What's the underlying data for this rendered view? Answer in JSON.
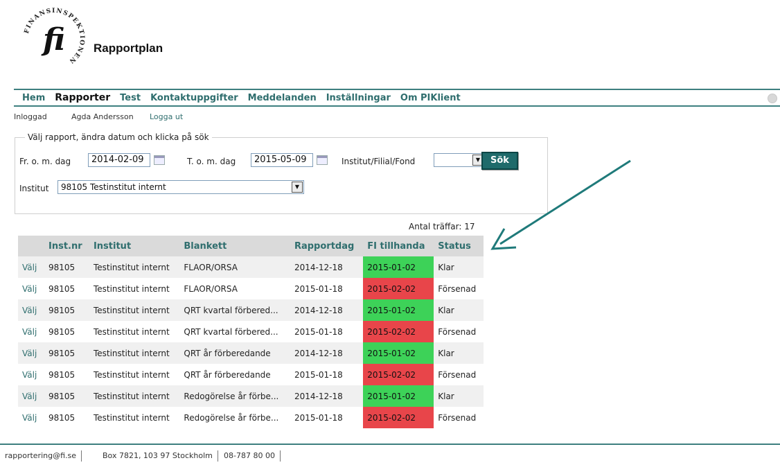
{
  "brand": {
    "ring_text": "FINANSINSPEKTIONEN",
    "monogram": "fi",
    "app_title": "Rapportplan"
  },
  "menu": {
    "items": [
      "Hem",
      "Rapporter",
      "Test",
      "Kontaktuppgifter",
      "Meddelanden",
      "Inställningar",
      "Om PIKlient"
    ],
    "active": "Rapporter"
  },
  "login": {
    "label": "Inloggad",
    "user": "Agda Andersson",
    "logout": "Logga ut"
  },
  "search": {
    "legend": "Välj rapport, ändra datum och klicka på sök",
    "from_label": "Fr. o. m. dag",
    "from_value": "2014-02-09",
    "to_label": "T. o. m. dag",
    "to_value": "2015-05-09",
    "entity_label": "Institut/Filial/Fond",
    "entity_value": "",
    "institut_label": "Institut",
    "institut_value": "98105 Testinstitut internt",
    "search_button": "Sök"
  },
  "results": {
    "hits_text": "Antal träffar: 17",
    "columns": [
      "",
      "Inst.nr",
      "Institut",
      "Blankett",
      "Rapportdag",
      "FI tillhanda",
      "Status"
    ],
    "rows": [
      {
        "action": "Välj",
        "inst_nr": "98105",
        "institut": "Testinstitut internt",
        "blankett": "FLAOR/ORSA",
        "rapportdag": "2014-12-18",
        "fi_tillhanda": "2015-01-02",
        "status": "Klar"
      },
      {
        "action": "Välj",
        "inst_nr": "98105",
        "institut": "Testinstitut internt",
        "blankett": "FLAOR/ORSA",
        "rapportdag": "2015-01-18",
        "fi_tillhanda": "2015-02-02",
        "status": "Försenad"
      },
      {
        "action": "Välj",
        "inst_nr": "98105",
        "institut": "Testinstitut internt",
        "blankett": "QRT kvartal förbered...",
        "rapportdag": "2014-12-18",
        "fi_tillhanda": "2015-01-02",
        "status": "Klar"
      },
      {
        "action": "Välj",
        "inst_nr": "98105",
        "institut": "Testinstitut internt",
        "blankett": "QRT kvartal förbered...",
        "rapportdag": "2015-01-18",
        "fi_tillhanda": "2015-02-02",
        "status": "Försenad"
      },
      {
        "action": "Välj",
        "inst_nr": "98105",
        "institut": "Testinstitut internt",
        "blankett": "QRT år förberedande",
        "rapportdag": "2014-12-18",
        "fi_tillhanda": "2015-01-02",
        "status": "Klar"
      },
      {
        "action": "Välj",
        "inst_nr": "98105",
        "institut": "Testinstitut internt",
        "blankett": "QRT år förberedande",
        "rapportdag": "2015-01-18",
        "fi_tillhanda": "2015-02-02",
        "status": "Försenad"
      },
      {
        "action": "Välj",
        "inst_nr": "98105",
        "institut": "Testinstitut internt",
        "blankett": "Redogörelse år förbe...",
        "rapportdag": "2014-12-18",
        "fi_tillhanda": "2015-01-02",
        "status": "Klar"
      },
      {
        "action": "Välj",
        "inst_nr": "98105",
        "institut": "Testinstitut internt",
        "blankett": "Redogörelse år förbe...",
        "rapportdag": "2015-01-18",
        "fi_tillhanda": "2015-02-02",
        "status": "Försenad"
      }
    ]
  },
  "footer": {
    "email": "rapportering@fi.se",
    "address": "Box 7821, 103 97 Stockholm",
    "phone": "08-787 80 00"
  },
  "colors": {
    "accent": "#2f6e6e",
    "status_ok": "#3dd258",
    "status_late": "#e8454a",
    "annotation_arrow": "#1f7a7a"
  },
  "icons": {
    "calendar": "calendar-icon",
    "dropdown": "chevron-down-icon",
    "annotation": "annotation-arrow-icon"
  }
}
